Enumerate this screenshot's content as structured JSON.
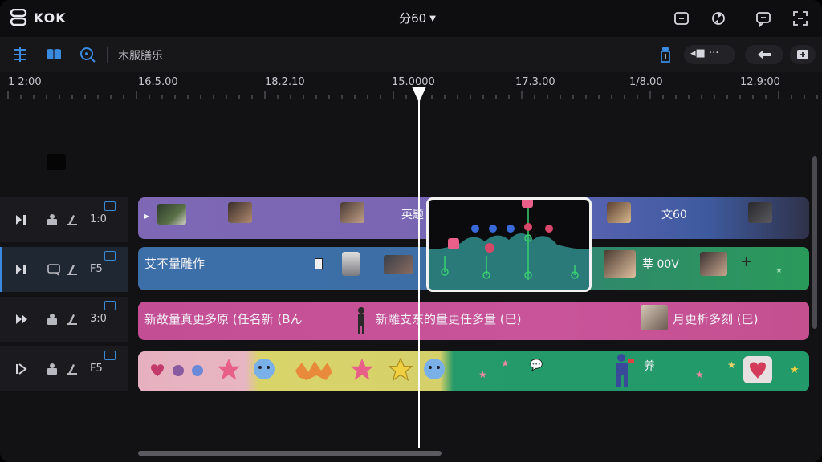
{
  "app": {
    "logo_text": "KOK",
    "title": "分60",
    "colors": {
      "accent": "#3a8ae0",
      "purple_track": "#7d68b4",
      "blue_track": "#3c6ea8",
      "pink_track": "#c64f95",
      "green_track": "#2e9a5a",
      "yellow_track": "#d9d06a"
    }
  },
  "topbar": {
    "icons": [
      "adjust-icon",
      "crop-icon",
      "sync-icon",
      "comment-icon",
      "expand-icon"
    ]
  },
  "toolbar": {
    "label": "木服膳乐",
    "icons": [
      "tracks-icon",
      "book-icon",
      "zoom-icon",
      "bottle-icon",
      "back-arrow-icon",
      "add-icon"
    ],
    "pill_dots": "◂■ ···"
  },
  "ruler": {
    "labels": [
      "1 2:00",
      "16.5.00",
      "18.2.10",
      "15.0000",
      "17.3.00",
      "1/8.00",
      "12.9:00"
    ]
  },
  "tracks": [
    {
      "number": "1:0"
    },
    {
      "number": "F5"
    },
    {
      "number": "3:0"
    },
    {
      "number": "F5"
    }
  ],
  "clips": {
    "track1_text_a": "英题",
    "track1_text_b": "文60",
    "track2_text_a": "艾不量雕作",
    "track2_text_b": "莘 00V",
    "track3_text_a": "新故量真更多原 (任名新 (Bん",
    "track3_text_b": "新雕支东的量更任多量 (巳)",
    "track3_text_c": "月更析多刻 (巳)",
    "track4_text_a": "养"
  }
}
